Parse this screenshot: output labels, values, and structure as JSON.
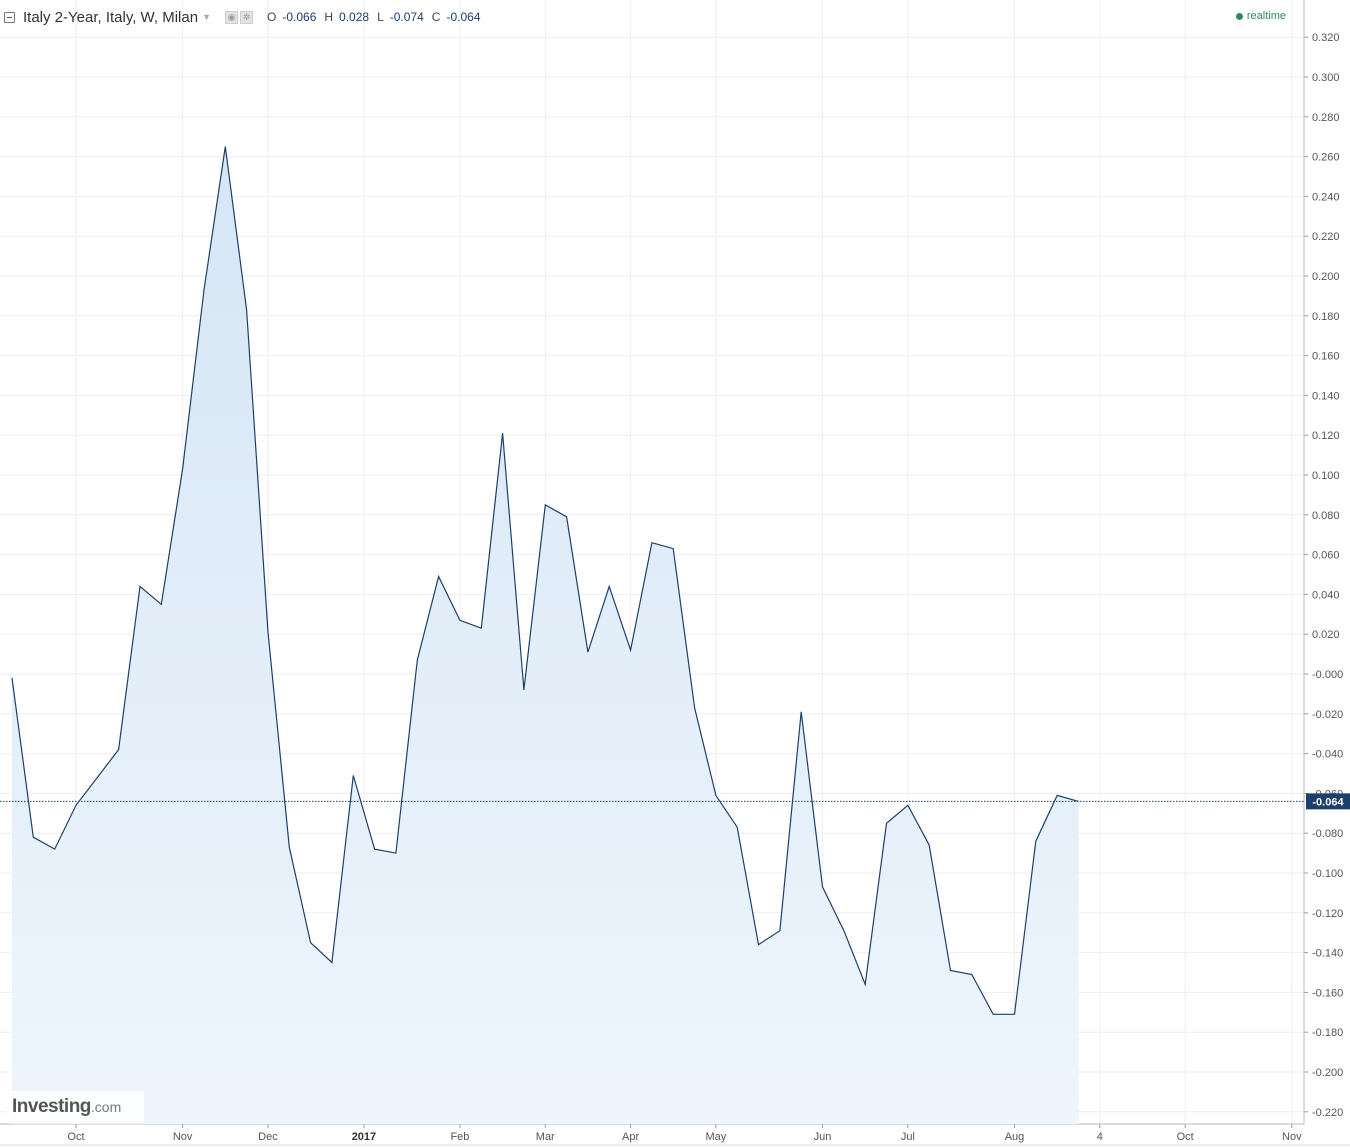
{
  "header": {
    "title": "Italy 2-Year, Italy, W, Milan",
    "ohlc": [
      {
        "key": "O",
        "value": "-0.066"
      },
      {
        "key": "H",
        "value": "0.028"
      },
      {
        "key": "L",
        "value": "-0.074"
      },
      {
        "key": "C",
        "value": "-0.064"
      }
    ],
    "realtime_label": "realtime"
  },
  "logo": {
    "brand": "Investing",
    "tld": ".com"
  },
  "colors": {
    "line": "#1d3f6b",
    "area_top": "#d6e6f5",
    "area_bottom": "#eef5fc",
    "grid": "#eeeeee",
    "price_tag": "#1d3f6b",
    "realtime": "#2e8b57"
  },
  "chart_data": {
    "type": "area",
    "title": "Italy 2-Year, Italy, W, Milan",
    "last_value": -0.064,
    "last_value_label": "-0.064",
    "ylim": [
      -0.23,
      0.33
    ],
    "y_ticks": [
      0.32,
      0.3,
      0.28,
      0.26,
      0.24,
      0.22,
      0.2,
      0.18,
      0.16,
      0.14,
      0.12,
      0.1,
      0.08,
      0.06,
      0.04,
      0.02,
      0.0,
      -0.02,
      -0.04,
      -0.06,
      -0.08,
      -0.1,
      -0.12,
      -0.14,
      -0.16,
      -0.18,
      -0.2,
      -0.22
    ],
    "y_tick_labels": [
      "0.320",
      "0.300",
      "0.280",
      "0.260",
      "0.240",
      "0.220",
      "0.200",
      "0.180",
      "0.160",
      "0.140",
      "0.120",
      "0.100",
      "0.080",
      "0.060",
      "0.040",
      "0.020",
      "-0.000",
      "-0.020",
      "-0.040",
      "-0.060",
      "-0.080",
      "-0.100",
      "-0.120",
      "-0.140",
      "-0.160",
      "-0.180",
      "-0.200",
      "-0.220"
    ],
    "x_range": [
      0,
      60
    ],
    "x_ticks": [
      {
        "pos": 3,
        "label": "Oct",
        "bold": false
      },
      {
        "pos": 8,
        "label": "Nov",
        "bold": false
      },
      {
        "pos": 12,
        "label": "Dec",
        "bold": false
      },
      {
        "pos": 16.5,
        "label": "2017",
        "bold": true
      },
      {
        "pos": 21,
        "label": "Feb",
        "bold": false
      },
      {
        "pos": 25,
        "label": "Mar",
        "bold": false
      },
      {
        "pos": 29,
        "label": "Apr",
        "bold": false
      },
      {
        "pos": 33,
        "label": "May",
        "bold": false
      },
      {
        "pos": 38,
        "label": "Jun",
        "bold": false
      },
      {
        "pos": 42,
        "label": "Jul",
        "bold": false
      },
      {
        "pos": 47,
        "label": "Aug",
        "bold": false
      },
      {
        "pos": 51,
        "label": "4",
        "bold": false
      },
      {
        "pos": 55,
        "label": "Oct",
        "bold": false
      },
      {
        "pos": 60,
        "label": "Nov",
        "bold": false
      }
    ],
    "series": [
      {
        "values": [
          -0.002,
          -0.082,
          -0.088,
          -0.066,
          -0.052,
          -0.038,
          0.044,
          0.035,
          0.103,
          0.193,
          0.265,
          0.183,
          0.021,
          -0.087,
          -0.135,
          -0.145,
          -0.051,
          -0.088,
          -0.09,
          0.007,
          0.049,
          0.027,
          0.023,
          0.121,
          -0.008,
          0.085,
          0.079,
          0.011,
          0.044,
          0.012,
          0.066,
          0.063,
          -0.017,
          -0.061,
          -0.077,
          -0.136,
          -0.129,
          -0.019,
          -0.107,
          -0.129,
          -0.156,
          -0.075,
          -0.066,
          -0.086,
          -0.149,
          -0.151,
          -0.171,
          -0.171,
          -0.084,
          -0.061,
          -0.064
        ]
      }
    ],
    "grid": true
  }
}
